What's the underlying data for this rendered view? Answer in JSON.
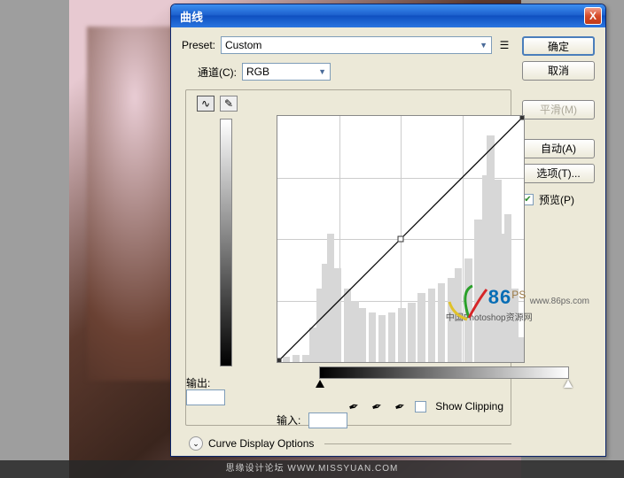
{
  "dialog": {
    "title": "曲线",
    "close": "X"
  },
  "preset": {
    "label": "Preset:",
    "value": "Custom"
  },
  "channel": {
    "label": "通道(C):",
    "value": "RGB"
  },
  "output": {
    "label": "输出:",
    "value": ""
  },
  "input": {
    "label": "输入:",
    "value": ""
  },
  "show_clipping": {
    "label": "Show Clipping",
    "checked": false
  },
  "curve_options": {
    "label": "Curve Display Options"
  },
  "buttons": {
    "ok": "确定",
    "cancel": "取消",
    "smooth": "平滑(M)",
    "auto": "自动(A)",
    "options": "选项(T)..."
  },
  "preview": {
    "label": "预览(P)",
    "checked": true
  },
  "watermark": {
    "brand": "86",
    "ps": "PS",
    "url": "www.86ps.com",
    "cn": "中国Photoshop资源网"
  },
  "footer": "思缘设计论坛  WWW.MISSYUAN.COM",
  "chart_data": {
    "type": "line",
    "title": "Curves",
    "xlabel": "输入",
    "ylabel": "输出",
    "xlim": [
      0,
      255
    ],
    "ylim": [
      0,
      255
    ],
    "grid": true,
    "series": [
      {
        "name": "RGB",
        "points": [
          {
            "in": 0,
            "out": 0
          },
          {
            "in": 128,
            "out": 128
          },
          {
            "in": 255,
            "out": 255
          }
        ]
      }
    ],
    "histogram_approx": [
      {
        "x": 5,
        "h": 2
      },
      {
        "x": 15,
        "h": 3
      },
      {
        "x": 25,
        "h": 3
      },
      {
        "x": 35,
        "h": 14
      },
      {
        "x": 40,
        "h": 30
      },
      {
        "x": 45,
        "h": 40
      },
      {
        "x": 52,
        "h": 52
      },
      {
        "x": 60,
        "h": 38
      },
      {
        "x": 68,
        "h": 30
      },
      {
        "x": 76,
        "h": 25
      },
      {
        "x": 85,
        "h": 22
      },
      {
        "x": 95,
        "h": 20
      },
      {
        "x": 105,
        "h": 19
      },
      {
        "x": 115,
        "h": 20
      },
      {
        "x": 125,
        "h": 22
      },
      {
        "x": 135,
        "h": 24
      },
      {
        "x": 145,
        "h": 28
      },
      {
        "x": 155,
        "h": 30
      },
      {
        "x": 165,
        "h": 32
      },
      {
        "x": 175,
        "h": 34
      },
      {
        "x": 185,
        "h": 38
      },
      {
        "x": 195,
        "h": 42
      },
      {
        "x": 205,
        "h": 58
      },
      {
        "x": 212,
        "h": 76
      },
      {
        "x": 218,
        "h": 92
      },
      {
        "x": 224,
        "h": 74
      },
      {
        "x": 230,
        "h": 52
      },
      {
        "x": 236,
        "h": 60
      },
      {
        "x": 242,
        "h": 30
      },
      {
        "x": 250,
        "h": 10
      }
    ]
  }
}
